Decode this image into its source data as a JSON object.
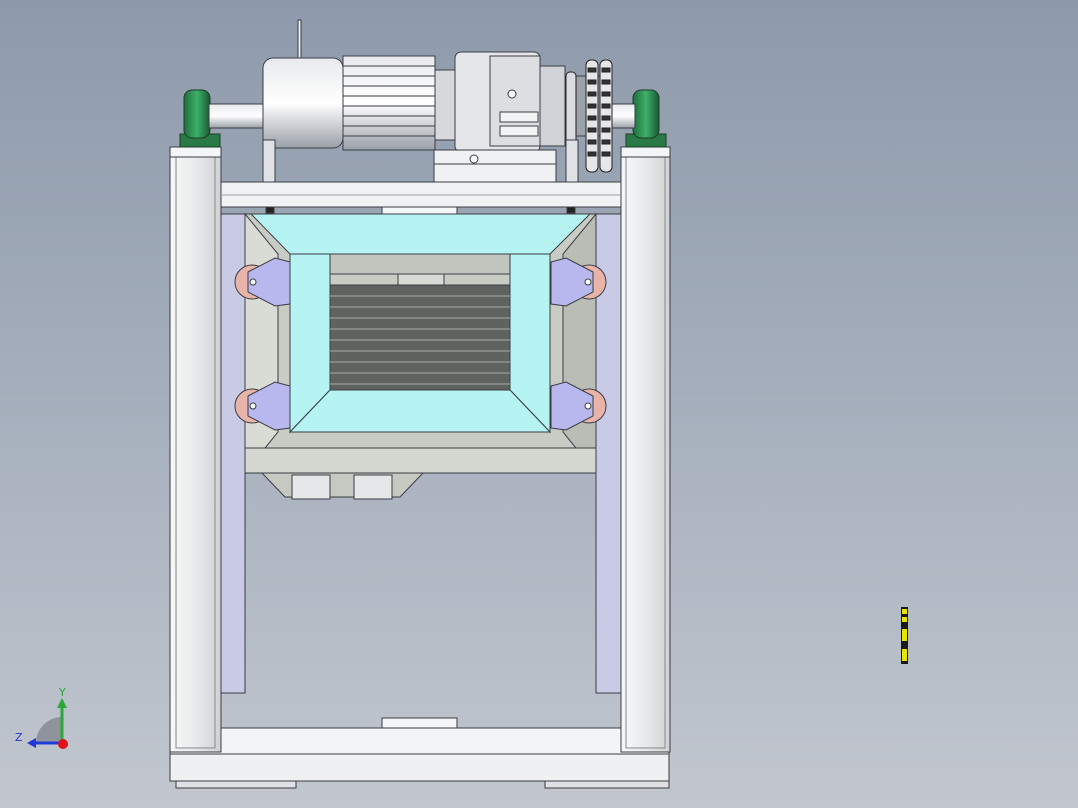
{
  "view": {
    "triad": {
      "y_label": "Y",
      "z_label": "Z"
    },
    "colors": {
      "frame": "#f1f2f4",
      "frame_edge": "#3a3d42",
      "side_plate": "#c9cbe6",
      "chute": "#b6f4f4",
      "bearing": "#2e8b57",
      "bracket": "#b9b8ee",
      "roller": "#e8b3a9",
      "coil": "#5f625f",
      "axis_x": "#e0101a",
      "axis_y": "#2aa83a",
      "axis_z": "#1f38d8",
      "marker": "#e6e600"
    }
  }
}
